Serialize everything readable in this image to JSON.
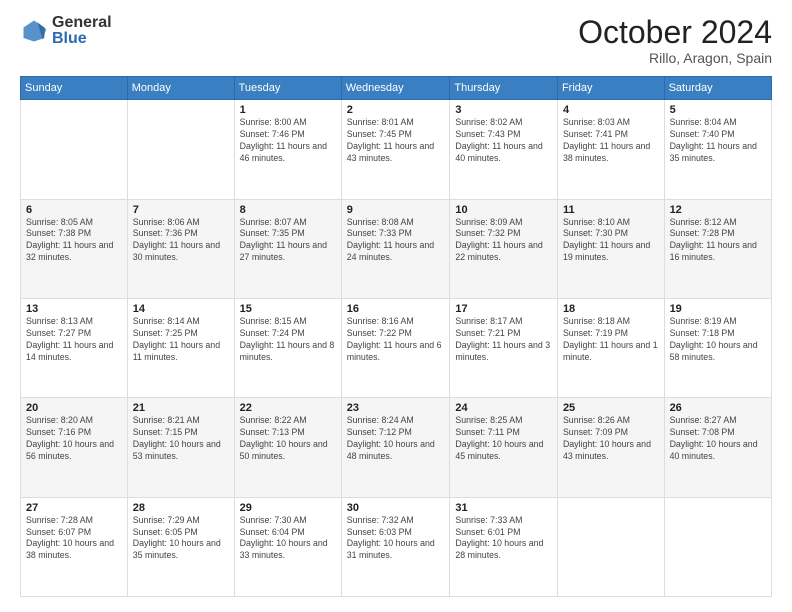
{
  "header": {
    "logo_general": "General",
    "logo_blue": "Blue",
    "month_title": "October 2024",
    "location": "Rillo, Aragon, Spain"
  },
  "calendar": {
    "days_of_week": [
      "Sunday",
      "Monday",
      "Tuesday",
      "Wednesday",
      "Thursday",
      "Friday",
      "Saturday"
    ],
    "weeks": [
      [
        {
          "day": "",
          "info": ""
        },
        {
          "day": "",
          "info": ""
        },
        {
          "day": "1",
          "info": "Sunrise: 8:00 AM\nSunset: 7:46 PM\nDaylight: 11 hours and 46 minutes."
        },
        {
          "day": "2",
          "info": "Sunrise: 8:01 AM\nSunset: 7:45 PM\nDaylight: 11 hours and 43 minutes."
        },
        {
          "day": "3",
          "info": "Sunrise: 8:02 AM\nSunset: 7:43 PM\nDaylight: 11 hours and 40 minutes."
        },
        {
          "day": "4",
          "info": "Sunrise: 8:03 AM\nSunset: 7:41 PM\nDaylight: 11 hours and 38 minutes."
        },
        {
          "day": "5",
          "info": "Sunrise: 8:04 AM\nSunset: 7:40 PM\nDaylight: 11 hours and 35 minutes."
        }
      ],
      [
        {
          "day": "6",
          "info": "Sunrise: 8:05 AM\nSunset: 7:38 PM\nDaylight: 11 hours and 32 minutes."
        },
        {
          "day": "7",
          "info": "Sunrise: 8:06 AM\nSunset: 7:36 PM\nDaylight: 11 hours and 30 minutes."
        },
        {
          "day": "8",
          "info": "Sunrise: 8:07 AM\nSunset: 7:35 PM\nDaylight: 11 hours and 27 minutes."
        },
        {
          "day": "9",
          "info": "Sunrise: 8:08 AM\nSunset: 7:33 PM\nDaylight: 11 hours and 24 minutes."
        },
        {
          "day": "10",
          "info": "Sunrise: 8:09 AM\nSunset: 7:32 PM\nDaylight: 11 hours and 22 minutes."
        },
        {
          "day": "11",
          "info": "Sunrise: 8:10 AM\nSunset: 7:30 PM\nDaylight: 11 hours and 19 minutes."
        },
        {
          "day": "12",
          "info": "Sunrise: 8:12 AM\nSunset: 7:28 PM\nDaylight: 11 hours and 16 minutes."
        }
      ],
      [
        {
          "day": "13",
          "info": "Sunrise: 8:13 AM\nSunset: 7:27 PM\nDaylight: 11 hours and 14 minutes."
        },
        {
          "day": "14",
          "info": "Sunrise: 8:14 AM\nSunset: 7:25 PM\nDaylight: 11 hours and 11 minutes."
        },
        {
          "day": "15",
          "info": "Sunrise: 8:15 AM\nSunset: 7:24 PM\nDaylight: 11 hours and 8 minutes."
        },
        {
          "day": "16",
          "info": "Sunrise: 8:16 AM\nSunset: 7:22 PM\nDaylight: 11 hours and 6 minutes."
        },
        {
          "day": "17",
          "info": "Sunrise: 8:17 AM\nSunset: 7:21 PM\nDaylight: 11 hours and 3 minutes."
        },
        {
          "day": "18",
          "info": "Sunrise: 8:18 AM\nSunset: 7:19 PM\nDaylight: 11 hours and 1 minute."
        },
        {
          "day": "19",
          "info": "Sunrise: 8:19 AM\nSunset: 7:18 PM\nDaylight: 10 hours and 58 minutes."
        }
      ],
      [
        {
          "day": "20",
          "info": "Sunrise: 8:20 AM\nSunset: 7:16 PM\nDaylight: 10 hours and 56 minutes."
        },
        {
          "day": "21",
          "info": "Sunrise: 8:21 AM\nSunset: 7:15 PM\nDaylight: 10 hours and 53 minutes."
        },
        {
          "day": "22",
          "info": "Sunrise: 8:22 AM\nSunset: 7:13 PM\nDaylight: 10 hours and 50 minutes."
        },
        {
          "day": "23",
          "info": "Sunrise: 8:24 AM\nSunset: 7:12 PM\nDaylight: 10 hours and 48 minutes."
        },
        {
          "day": "24",
          "info": "Sunrise: 8:25 AM\nSunset: 7:11 PM\nDaylight: 10 hours and 45 minutes."
        },
        {
          "day": "25",
          "info": "Sunrise: 8:26 AM\nSunset: 7:09 PM\nDaylight: 10 hours and 43 minutes."
        },
        {
          "day": "26",
          "info": "Sunrise: 8:27 AM\nSunset: 7:08 PM\nDaylight: 10 hours and 40 minutes."
        }
      ],
      [
        {
          "day": "27",
          "info": "Sunrise: 7:28 AM\nSunset: 6:07 PM\nDaylight: 10 hours and 38 minutes."
        },
        {
          "day": "28",
          "info": "Sunrise: 7:29 AM\nSunset: 6:05 PM\nDaylight: 10 hours and 35 minutes."
        },
        {
          "day": "29",
          "info": "Sunrise: 7:30 AM\nSunset: 6:04 PM\nDaylight: 10 hours and 33 minutes."
        },
        {
          "day": "30",
          "info": "Sunrise: 7:32 AM\nSunset: 6:03 PM\nDaylight: 10 hours and 31 minutes."
        },
        {
          "day": "31",
          "info": "Sunrise: 7:33 AM\nSunset: 6:01 PM\nDaylight: 10 hours and 28 minutes."
        },
        {
          "day": "",
          "info": ""
        },
        {
          "day": "",
          "info": ""
        }
      ]
    ]
  }
}
